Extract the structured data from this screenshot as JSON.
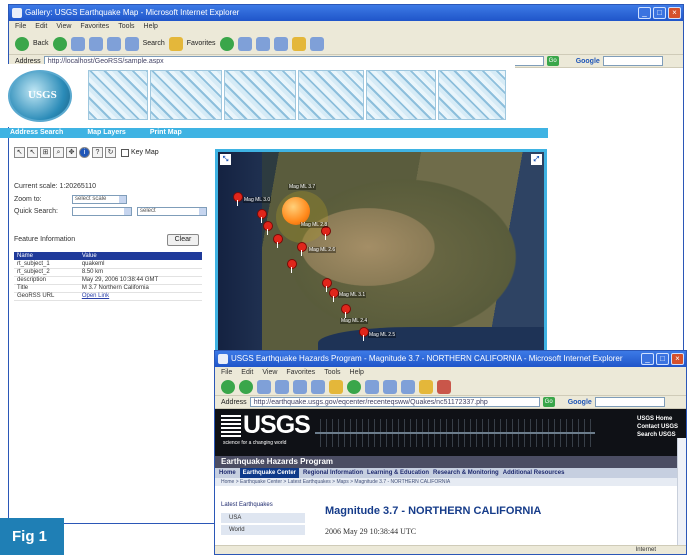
{
  "main_window": {
    "title": "Gallery: USGS Earthquake Map - Microsoft Internet Explorer",
    "menu": [
      "File",
      "Edit",
      "View",
      "Favorites",
      "Tools",
      "Help"
    ],
    "toolbar": {
      "back": "Back",
      "search": "Search",
      "favorites": "Favorites"
    },
    "address_label": "Address",
    "address": "http://localhost/GeoRSS/sample.aspx",
    "go": "Go",
    "google": "Google"
  },
  "nav": [
    "Address Search",
    "Map Layers",
    "Print Map"
  ],
  "map_tools": {
    "key_map_label": "Key Map"
  },
  "left_panel": {
    "current_scale_label": "Current scale: 1:20265110",
    "zoom_to_label": "Zoom to:",
    "zoom_to_value": "select scale",
    "quick_search_label": "Quick Search:",
    "quick_search_value": "",
    "quick_search_select": "select",
    "feature_info_label": "Feature Information",
    "clear_button": "Clear",
    "table_headers": [
      "Name",
      "Value"
    ],
    "table_rows": [
      {
        "name": "rt_subject_1",
        "value": "quakeml"
      },
      {
        "name": "rt_subject_2",
        "value": "8.50 km"
      },
      {
        "name": "description",
        "value": "May 29, 2006 10:38:44 GMT"
      },
      {
        "name": "Title",
        "value": "M 3.7 Northern California"
      },
      {
        "name": "GeoRSS URL",
        "value": "Open Link"
      }
    ]
  },
  "map_labels": [
    "Mag ML 3.0",
    "Mag ML 3.7",
    "Mag ML 2.6",
    "Mag ML 2.8",
    "Mag ML 3.1",
    "Mag ML 2.4",
    "Mag ML 2.5"
  ],
  "popup_window": {
    "title": "USGS Earthquake Hazards Program - Magnitude 3.7 - NORTHERN CALIFORNIA - Microsoft Internet Explorer",
    "menu": [
      "File",
      "Edit",
      "View",
      "Favorites",
      "Tools",
      "Help"
    ],
    "address_label": "Address",
    "address": "http://earthquake.usgs.gov/eqcenter/recenteqsww/Quakes/nc51172337.php",
    "go": "Go",
    "google": "Google",
    "logo": "USGS",
    "tagline": "science for a changing world",
    "right_links": [
      "USGS Home",
      "Contact USGS",
      "Search USGS"
    ],
    "program": "Earthquake Hazards Program",
    "tabs": [
      "Home",
      "Earthquake Center",
      "Regional Information",
      "Learning & Education",
      "Research & Monitoring",
      "Additional Resources"
    ],
    "active_tab": "Earthquake Center",
    "breadcrumb": "Home > Earthquake Center > Latest Earthquakes > Maps > Magnitude 3.7 - NORTHERN CALIFORNIA",
    "side_heading": "Latest Earthquakes",
    "side_items": [
      "USA",
      "World"
    ],
    "heading": "Magnitude 3.7 - NORTHERN CALIFORNIA",
    "datetime": "2006 May 29 10:38:44 UTC",
    "status": "Internet"
  },
  "figure_label": "Fig 1"
}
